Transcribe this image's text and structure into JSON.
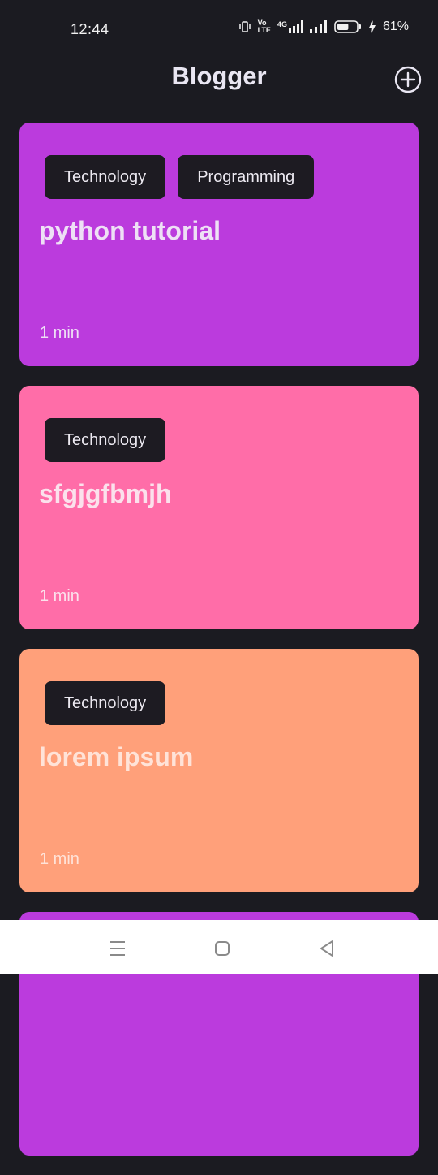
{
  "status_bar": {
    "time": "12:44",
    "network_vo": "Vo",
    "network_lte": "LTE",
    "network_type": "4G",
    "battery_percent": "61%",
    "battery_level": 0.61
  },
  "app_bar": {
    "title": "Blogger",
    "add_icon": "plus-circle-icon"
  },
  "posts": [
    {
      "tags": [
        "Technology",
        "Programming"
      ],
      "title": "python tutorial",
      "read_time": "1 min",
      "color": "#bb3bdd",
      "text_color": "#eee0f5"
    },
    {
      "tags": [
        "Technology"
      ],
      "title": "sfgjgfbmjh",
      "read_time": "1 min",
      "color": "#ff6da8",
      "text_color": "#fbe1ec"
    },
    {
      "tags": [
        "Technology"
      ],
      "title": "lorem ipsum",
      "read_time": "1 min",
      "color": "#ffa07a",
      "text_color": "#ffe3d8"
    },
    {
      "color": "#bb3bdd"
    }
  ],
  "nav_bar": {
    "icons": [
      "menu-icon",
      "home-square-icon",
      "back-triangle-icon"
    ]
  }
}
